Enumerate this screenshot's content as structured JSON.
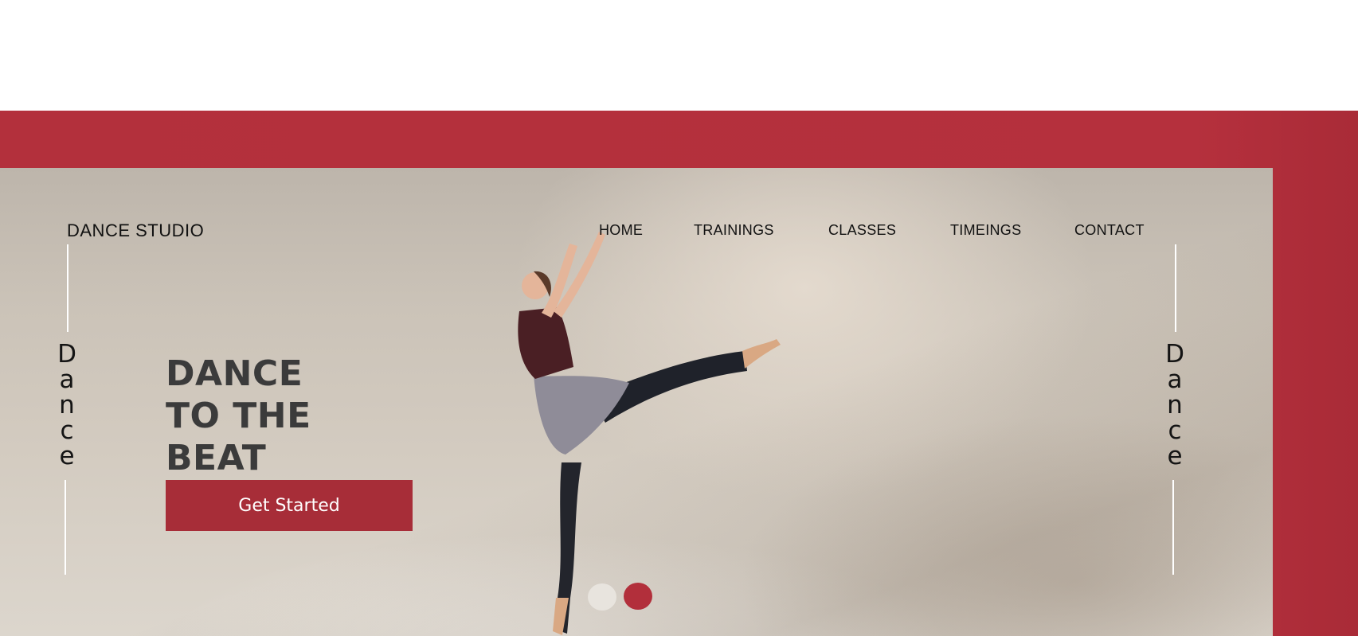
{
  "brand": {
    "name": "DANCE STUDIO"
  },
  "nav": {
    "items": [
      {
        "label": "HOME"
      },
      {
        "label": "TRAININGS"
      },
      {
        "label": "CLASSES"
      },
      {
        "label": "TIMEINGS"
      },
      {
        "label": "CONTACT"
      }
    ]
  },
  "side_text": {
    "left": "Dance",
    "right": "Dance"
  },
  "hero": {
    "headline_lines": [
      "DANCE",
      "TO THE",
      "BEAT"
    ],
    "cta_label": "Get Started"
  },
  "slider": {
    "dot_count": 2,
    "active_index": 1
  },
  "colors": {
    "accent": "#b3303c",
    "button": "#a72d38",
    "headline": "#3b3b3b",
    "nav_text": "#111111"
  }
}
